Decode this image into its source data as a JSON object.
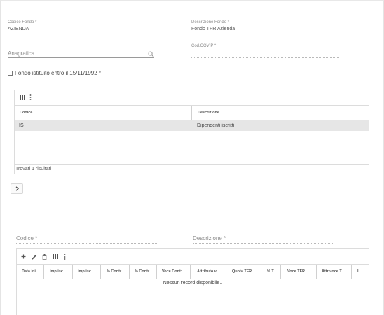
{
  "form": {
    "codice_fondo_label": "Codice Fondo *",
    "codice_fondo_value": "AZIENDA",
    "descrizione_fondo_label": "Descrizione Fondo *",
    "descrizione_fondo_value": "Fondo TFR Azienda",
    "anagrafica_placeholder": "Anagrafica",
    "cod_covip_label": "Cod.COVIP *",
    "cod_covip_value": "",
    "checkbox_label": "Fondo istituito entro il 15/11/1992 *"
  },
  "grid1": {
    "columns": [
      "Codice",
      "Descrizione"
    ],
    "rows": [
      {
        "codice": "IS",
        "descrizione": "Dipendenti iscritti"
      }
    ],
    "footer": "Trovati 1 risultati"
  },
  "expand_button": {
    "icon": "chevron-right-icon"
  },
  "form2": {
    "codice_placeholder": "Codice *",
    "descrizione_placeholder": "Descrizione *"
  },
  "grid2": {
    "columns": [
      "Data ini...",
      "Imp isc...",
      "Imp isc...",
      "% Contr...",
      "% Contr...",
      "Voce Contr...",
      "Attributo v...",
      "Quota TFR",
      "% T...",
      "Voce TFR",
      "Attr voce T...",
      "I..."
    ],
    "empty_message": "Nessun record disponibile.."
  },
  "colors": {
    "selected_row": "#e6e6e6",
    "border": "#dcdcdc",
    "icon": "#555555"
  }
}
